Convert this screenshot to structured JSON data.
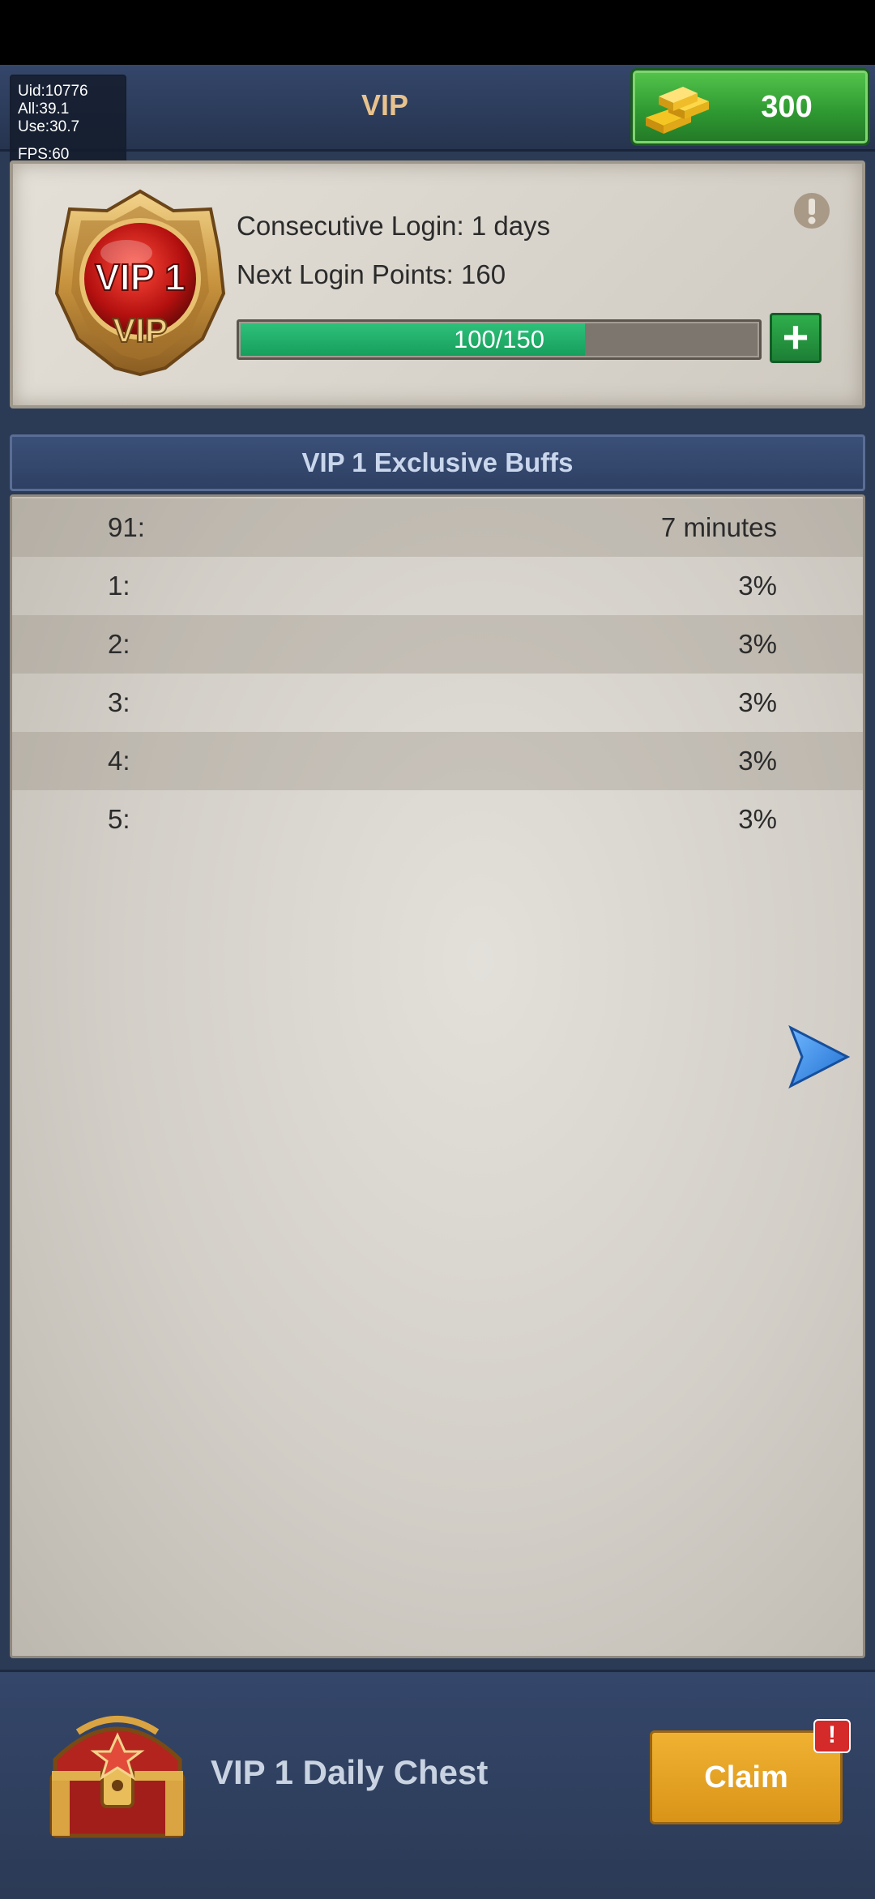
{
  "header": {
    "title": "VIP"
  },
  "debug": {
    "uid": "Uid:10776",
    "all": "All:39.1",
    "use": "Use:30.7",
    "fps": "FPS:60"
  },
  "currency": {
    "icon": "gold-bars-icon",
    "value": "300"
  },
  "vip_card": {
    "badge_level": "VIP 1",
    "badge_sub": "VIP",
    "consecutive_login": "Consecutive Login: 1 days",
    "next_login_points": "Next Login Points: 160",
    "progress": {
      "current": 100,
      "max": 150,
      "label": "100/150"
    }
  },
  "buffs": {
    "title": "VIP 1 Exclusive Buffs",
    "rows": [
      {
        "key": "91:",
        "value": "7 minutes"
      },
      {
        "key": "1:",
        "value": "3%"
      },
      {
        "key": "2:",
        "value": "3%"
      },
      {
        "key": "3:",
        "value": "3%"
      },
      {
        "key": "4:",
        "value": "3%"
      },
      {
        "key": "5:",
        "value": "3%"
      }
    ]
  },
  "chest": {
    "label": "VIP 1 Daily Chest",
    "claim_label": "Claim",
    "alert": "!"
  },
  "colors": {
    "accent_green": "#2ec07a",
    "gold_text": "#e8c28d",
    "claim_orange": "#f0b232"
  }
}
